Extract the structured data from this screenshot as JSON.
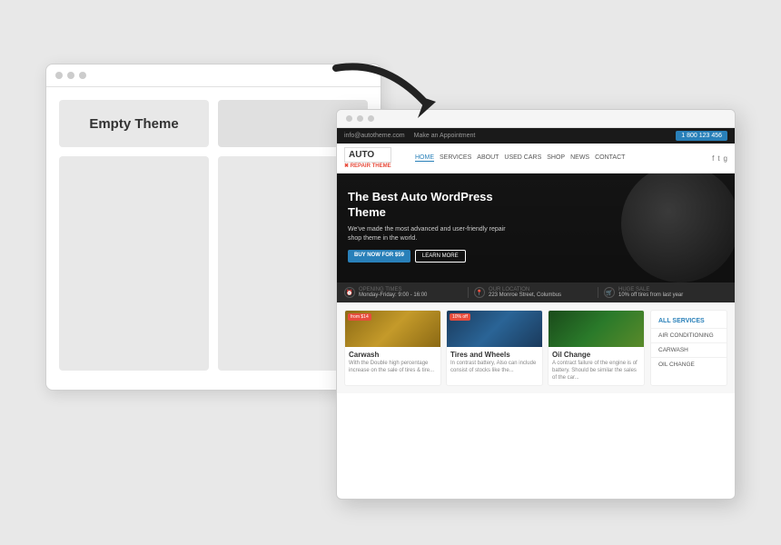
{
  "scene": {
    "background_color": "#e8e8e8"
  },
  "empty_browser": {
    "dots": [
      "dot1",
      "dot2",
      "dot3"
    ],
    "empty_theme_label": "Empty Theme"
  },
  "arrow": {
    "description": "curved arrow pointing right-down"
  },
  "auto_browser": {
    "dots": [
      "dot1",
      "dot2",
      "dot3"
    ],
    "top_bar": {
      "email": "info@autotheme.com",
      "appointment": "Make an Appointment",
      "phone": "1 800 123 456"
    },
    "nav": {
      "logo_text": "AUTO",
      "logo_subtitle": "REPAIR THEME",
      "links": [
        "HOME",
        "SERVICES",
        "ABOUT",
        "USED CARS",
        "SHOP",
        "NEWS",
        "CONTACT"
      ],
      "active_link": "HOME"
    },
    "hero": {
      "title": "The Best Auto WordPress Theme",
      "subtitle": "We've made the most advanced and user-friendly repair shop theme in the world.",
      "btn_primary": "BUY NOW FOR $59",
      "btn_secondary": "LEARN MORE"
    },
    "info_strip": [
      {
        "icon": "⏰",
        "label": "OPENING TIMES",
        "value": "Monday-Friday: 9:00 - 16:00"
      },
      {
        "icon": "📍",
        "label": "OUR LOCATION",
        "value": "223 Monroe Street, Columbus"
      },
      {
        "icon": "🛒",
        "label": "HUGE SALE",
        "value": "10% off tires from last year"
      }
    ],
    "service_cards": [
      {
        "title": "Carwash",
        "badge": "from $14",
        "badge_color": "red",
        "desc": "With the Double high percentage increase on the sale of tires & tire..."
      },
      {
        "title": "Tires and Wheels",
        "badge": "10% off",
        "badge_color": "red",
        "desc": "In contrast battery, Also can include consist of stocks like the..."
      },
      {
        "title": "Oil Change",
        "badge": "",
        "badge_color": "",
        "desc": "A contract failure of the engine is of battery. Should be similar the sales of the car..."
      }
    ],
    "sidebar_items": [
      "ALL SERVICES",
      "AIR CONDITIONING",
      "CARWASH",
      "OIL CHANGE"
    ]
  }
}
